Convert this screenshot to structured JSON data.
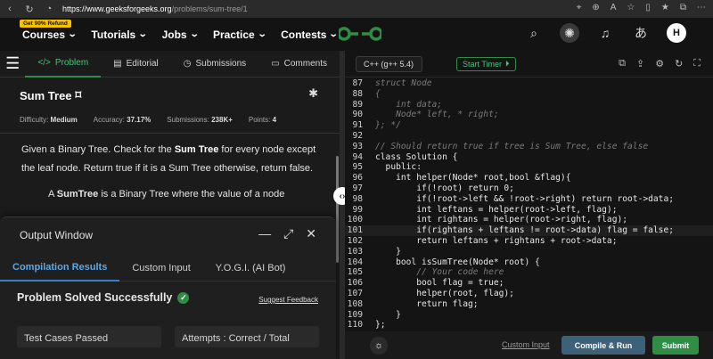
{
  "browser": {
    "url_host": "https://www.geeksforgeeks.org",
    "url_path": "/problems/sum-tree/1"
  },
  "header": {
    "refund_badge": "Get 90% Refund",
    "nav": [
      "Courses",
      "Tutorials",
      "Jobs",
      "Practice",
      "Contests"
    ],
    "avatar_letter": "H",
    "translate_glyph": "あ"
  },
  "left_tabs": [
    "Problem",
    "Editorial",
    "Submissions",
    "Comments"
  ],
  "problem": {
    "title": "Sum Tree",
    "difficulty_label": "Difficulty:",
    "difficulty": "Medium",
    "accuracy_label": "Accuracy:",
    "accuracy": "37.17%",
    "submissions_label": "Submissions:",
    "submissions": "238K+",
    "points_label": "Points:",
    "points": "4",
    "desc_before": "Given a Binary Tree. Check for the ",
    "desc_bold": "Sum Tree",
    "desc_after": " for every node except the leaf node. Return true if it is a Sum Tree otherwise, return false.",
    "desc2_before": "A ",
    "desc2_bold": "SumTree",
    "desc2_after": " is a Binary Tree where the value of a node"
  },
  "output_window": {
    "title": "Output Window",
    "tabs": [
      "Compilation Results",
      "Custom Input",
      "Y.O.G.I. (AI Bot)"
    ],
    "status": "Problem Solved Successfully",
    "suggest_feedback": "Suggest Feedback",
    "test_cases_label": "Test Cases Passed",
    "attempts_label": "Attempts : Correct / Total"
  },
  "editor": {
    "language": "C++ (g++ 5.4)",
    "start_timer": "Start Timer",
    "custom_input": "Custom Input",
    "compile_run": "Compile & Run",
    "submit": "Submit",
    "lines": [
      {
        "n": "87",
        "t": "struct Node",
        "c": true
      },
      {
        "n": "88",
        "t": "{",
        "c": true
      },
      {
        "n": "89",
        "t": "    int data;",
        "c": true
      },
      {
        "n": "90",
        "t": "    Node* left, * right;",
        "c": true
      },
      {
        "n": "91",
        "t": "}; */",
        "c": true
      },
      {
        "n": "92",
        "t": "",
        "c": false
      },
      {
        "n": "93",
        "t": "// Should return true if tree is Sum Tree, else false",
        "c": true
      },
      {
        "n": "94",
        "t": "class Solution {",
        "c": false
      },
      {
        "n": "95",
        "t": "  public:",
        "c": false
      },
      {
        "n": "96",
        "t": "    int helper(Node* root,bool &flag){",
        "c": false
      },
      {
        "n": "97",
        "t": "        if(!root) return 0;",
        "c": false
      },
      {
        "n": "98",
        "t": "        if(!root->left && !root->right) return root->data;",
        "c": false
      },
      {
        "n": "99",
        "t": "        int leftans = helper(root->left, flag);",
        "c": false
      },
      {
        "n": "100",
        "t": "        int rightans = helper(root->right, flag);",
        "c": false
      },
      {
        "n": "101",
        "t": "        if(rightans + leftans != root->data) flag = false;",
        "c": false,
        "hl": true
      },
      {
        "n": "102",
        "t": "        return leftans + rightans + root->data;",
        "c": false
      },
      {
        "n": "103",
        "t": "    }",
        "c": false
      },
      {
        "n": "104",
        "t": "    bool isSumTree(Node* root) {",
        "c": false
      },
      {
        "n": "105",
        "t": "        // Your code here",
        "c": true
      },
      {
        "n": "106",
        "t": "        bool flag = true;",
        "c": false
      },
      {
        "n": "107",
        "t": "        helper(root, flag);",
        "c": false
      },
      {
        "n": "108",
        "t": "        return flag;",
        "c": false
      },
      {
        "n": "109",
        "t": "    }",
        "c": false
      },
      {
        "n": "110",
        "t": "};",
        "c": false
      }
    ]
  }
}
